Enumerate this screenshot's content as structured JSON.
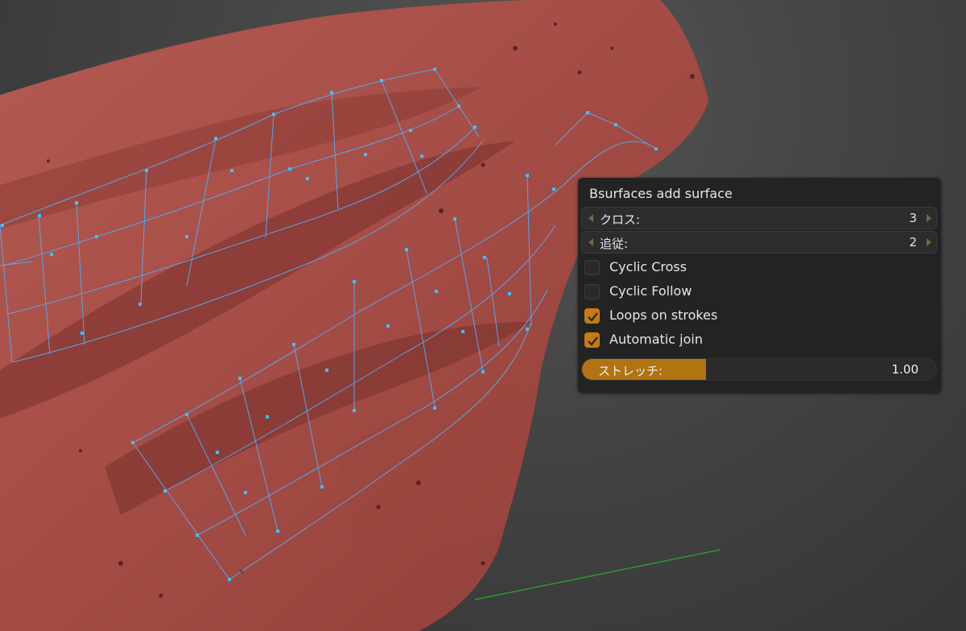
{
  "panel": {
    "title": "Bsurfaces add surface",
    "fields": [
      {
        "label": "クロス:",
        "value": "3"
      },
      {
        "label": "追従:",
        "value": "2"
      }
    ],
    "checkboxes": [
      {
        "label": "Cyclic Cross",
        "checked": false
      },
      {
        "label": "Cyclic Follow",
        "checked": false
      },
      {
        "label": "Loops on strokes",
        "checked": true
      },
      {
        "label": "Automatic join",
        "checked": true
      }
    ],
    "slider": {
      "label": "ストレッチ:",
      "value": "1.00",
      "fill_fraction": 0.35
    }
  },
  "colors": {
    "mesh": "#a8504a",
    "mesh_dark": "#5a2220",
    "grid_lines": "#5aa8f0",
    "grid_vertices": "#3ec0ff",
    "accent": "#c77c12",
    "axis_green": "#2e9a2e"
  }
}
